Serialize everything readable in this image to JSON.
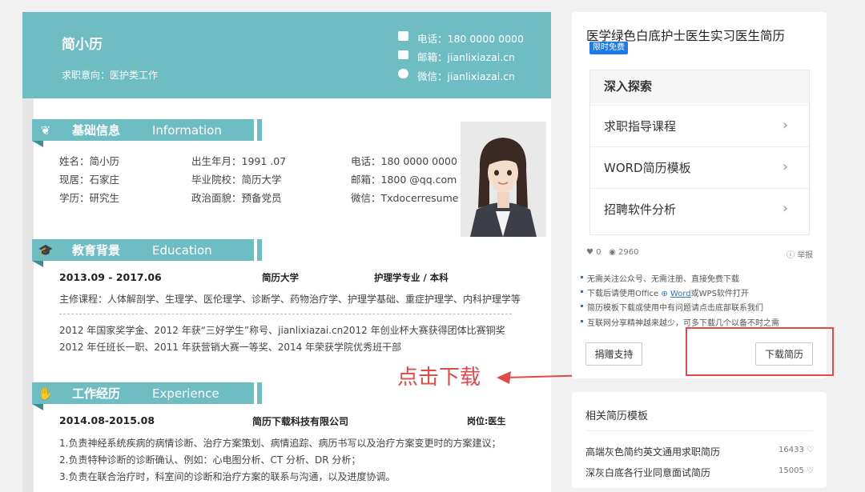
{
  "resume": {
    "name": "简小历",
    "intent_label": "求职意向：",
    "intent_value": "医护类工作",
    "contact": {
      "phone": "电话：180 0000 0000",
      "email": "邮箱：jianlixiazai.cn",
      "wechat": "微信：jianlixiazai.cn"
    },
    "sections": {
      "basic": {
        "cn": "基础信息",
        "en": "Information"
      },
      "edu": {
        "cn": "教育背景",
        "en": "Education"
      },
      "work": {
        "cn": "工作经历",
        "en": "Experience"
      }
    },
    "basic_info": [
      [
        "姓名：简小历",
        "出生年月：1991 .07",
        "电话：180 0000 0000"
      ],
      [
        "现居：石家庄",
        "毕业院校：简历大学",
        "邮箱：1800 @qq.com"
      ],
      [
        "学历：研究生",
        "政治面貌：预备党员",
        "微信：Txdocerresume"
      ]
    ],
    "education": {
      "period": "2013.09 - 2017.06",
      "school": "简历大学",
      "major": "护理学专业 / 本科",
      "courses": "主修课程：人体解剖学、生理学、医伦理学、诊断学、药物治疗学、护理学基础、重症护理学、内科护理学等",
      "honor1": "2012 年国家奖学金、2012 年获“三好学生”称号、jianlixiazai.cn2012 年创业杯大赛获得团体比赛铜奖",
      "honor2": "2012 年任班长一职、2011 年获营销大赛一等奖、2014 年荣获学院优秀班干部"
    },
    "work": {
      "period": "2014.08-2015.08",
      "company": "简历下载科技有限公司",
      "position": "岗位:医生",
      "duty1": "1.负责神经系统疾病的病情诊断、治疗方案策划、病情追踪、病历书写以及治疗方案变更时的方案建议；",
      "duty2": "2.负责特种诊断的诊断确认、例如：心电图分析、CT 分析、DR 分析；",
      "duty3": "3.负责在联合治疗时，科室间的诊断和治疗方案的联系与沟通，以及进度协调。"
    }
  },
  "annotation": {
    "text": "点击下载",
    "color": "#e04a4a"
  },
  "sidebar": {
    "title": "医学绿色白底护士医生实习医生简历",
    "badge": "限时免费",
    "explore_title": "深入探索",
    "explore_items": [
      "求职指导课程",
      "WORD简历模板",
      "招聘软件分析"
    ],
    "likes": "0",
    "views": "2960",
    "report": "举报",
    "notes": [
      "无需关注公众号、无需注册、直接免费下载",
      "下载后请使用Office ",
      "Word",
      "或WPS软件打开",
      "简历模板下载或使用中有问题请点击底部联系我们",
      "互联网分享精神越来越少，可多下载几个以备不时之需"
    ],
    "donate_label": "捐赠支持",
    "download_label": "下载简历",
    "related_title": "相关简历模板",
    "related": [
      {
        "name": "高端灰色简约英文通用求职简历",
        "count": "16433"
      },
      {
        "name": "深灰白底各行业同意面试简历",
        "count": "15005"
      }
    ]
  },
  "colors": {
    "accent": "#6ebdc2",
    "accent_dark": "#3d8c91",
    "link": "#2e74c9",
    "highlight": "#e04a4a"
  }
}
